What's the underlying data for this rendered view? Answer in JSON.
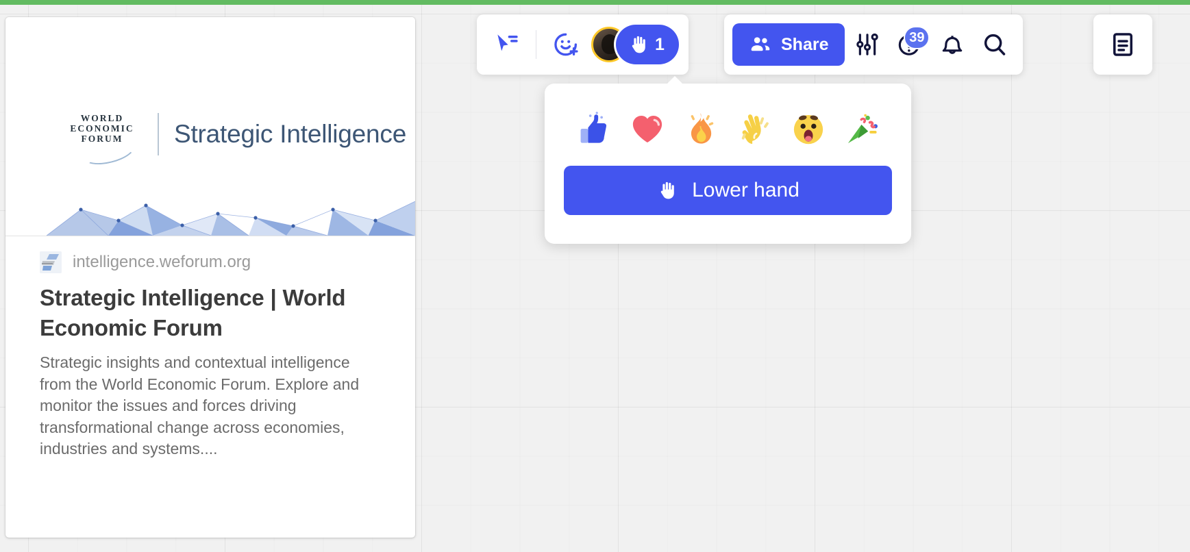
{
  "app": {
    "accent_blue": "#4355ef",
    "top_accent_green": "#62bb61",
    "canvas_background": "#f1f1f1",
    "avatar_ring_color": "#ffc829"
  },
  "toolbar_main": {
    "cursor_tool": {
      "icon": "pointer-select-icon",
      "label": "Select"
    },
    "add_reaction": {
      "icon": "smiley-plus-icon",
      "label": "Add reaction"
    },
    "participant_avatar": {
      "icon": "avatar",
      "label": "Participant"
    },
    "raised_hand": {
      "icon": "raised-hand-icon",
      "count": "1",
      "label": "Raised hands"
    }
  },
  "toolbar_actions": {
    "share": {
      "label": "Share",
      "icon": "people-icon"
    },
    "settings": {
      "icon": "sliders-icon",
      "label": "Settings"
    },
    "help": {
      "icon": "question-circle-icon",
      "label": "Help",
      "badge": "39"
    },
    "notifications": {
      "icon": "bell-icon",
      "label": "Notifications"
    },
    "search": {
      "icon": "search-icon",
      "label": "Search"
    }
  },
  "toolbar_notes": {
    "notes": {
      "icon": "document-lines-icon",
      "label": "Notes"
    }
  },
  "reactions_popover": {
    "emojis": [
      {
        "name": "thumbs-up-emoji",
        "glyph": "👍"
      },
      {
        "name": "heart-emoji",
        "glyph": "❤️"
      },
      {
        "name": "fire-emoji",
        "glyph": "🔥"
      },
      {
        "name": "waving-hand-emoji",
        "glyph": "👋"
      },
      {
        "name": "astonished-face-emoji",
        "glyph": "😮"
      },
      {
        "name": "party-popper-emoji",
        "glyph": "🎉"
      }
    ],
    "lower_hand": {
      "label": "Lower hand",
      "icon": "raised-hand-icon"
    }
  },
  "link_card": {
    "hero": {
      "logo_line_1": "WORLD",
      "logo_line_2": "ECONOMIC",
      "logo_line_3": "FORUM",
      "lockup_title": "Strategic Intelligence"
    },
    "source_url": "intelligence.weforum.org",
    "title": "Strategic Intelligence | World Economic Forum",
    "description": "Strategic insights and contextual intelligence from the World Economic Forum. Explore and monitor the issues and forces driving transformational change across economies, industries and systems...."
  }
}
